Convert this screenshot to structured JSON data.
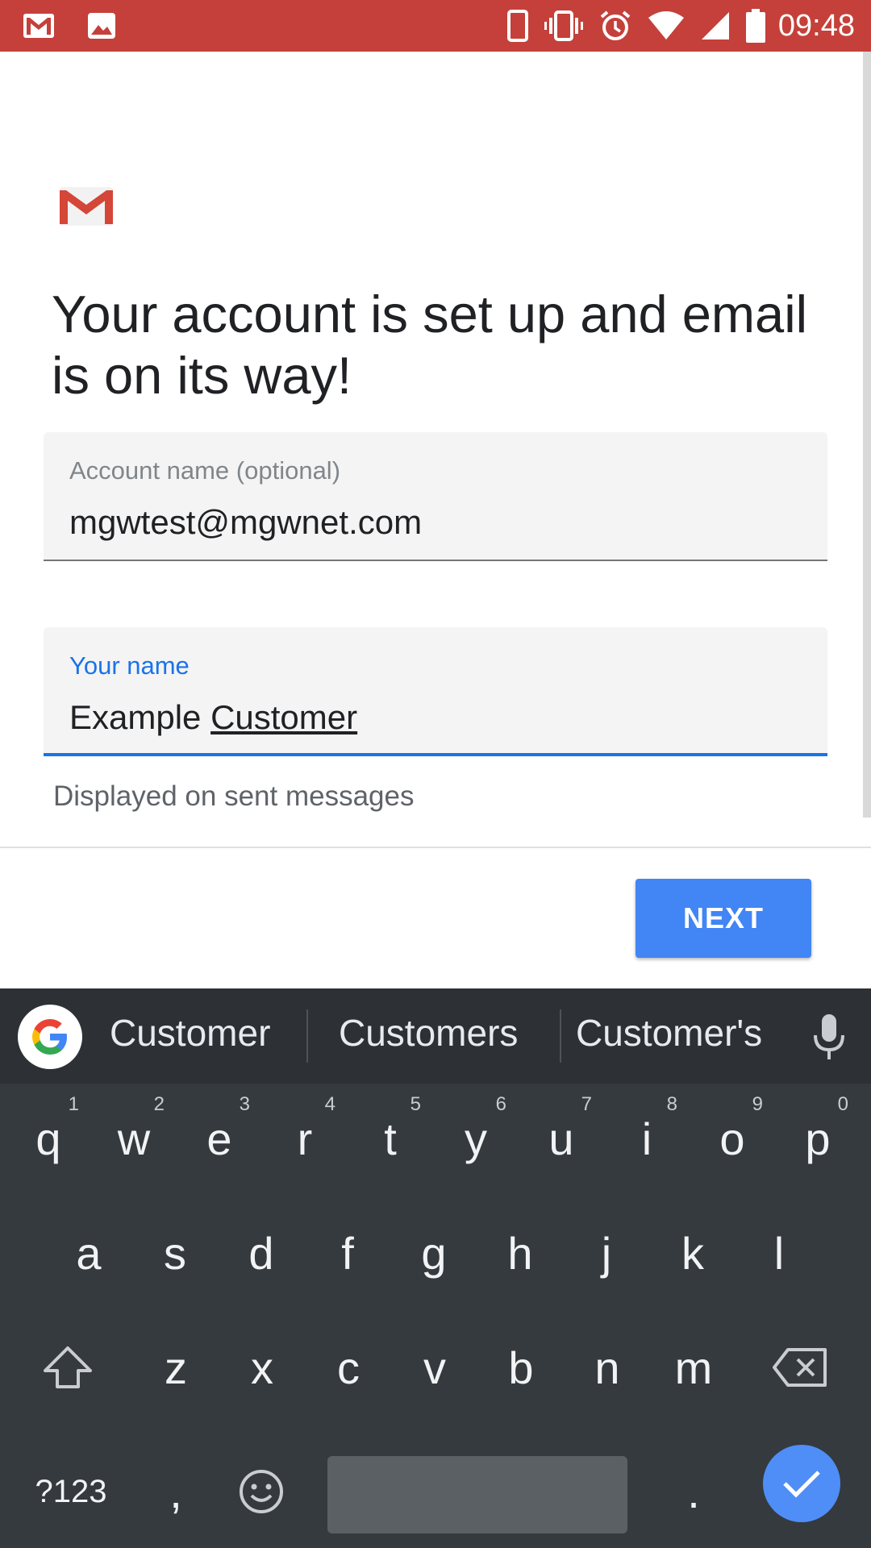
{
  "status_bar": {
    "time": "09:48",
    "left_icons": [
      "gmail-notification-icon",
      "image-notification-icon"
    ],
    "right_icons": [
      "phone-icon",
      "vibrate-icon",
      "alarm-icon",
      "wifi-icon",
      "signal-icon",
      "battery-icon"
    ]
  },
  "page": {
    "title": "Your account is set up and email is on its way!",
    "account_field": {
      "label": "Account name (optional)",
      "value": "mgwtest@mgwnet.com"
    },
    "name_field": {
      "label": "Your name",
      "value_first": "Example ",
      "value_composing": "Customer"
    },
    "helper_text": "Displayed on sent messages",
    "next_label": "NEXT"
  },
  "keyboard": {
    "suggestions": [
      "Customer",
      "Customers",
      "Customer's"
    ],
    "row1": [
      {
        "k": "q",
        "h": "1"
      },
      {
        "k": "w",
        "h": "2"
      },
      {
        "k": "e",
        "h": "3"
      },
      {
        "k": "r",
        "h": "4"
      },
      {
        "k": "t",
        "h": "5"
      },
      {
        "k": "y",
        "h": "6"
      },
      {
        "k": "u",
        "h": "7"
      },
      {
        "k": "i",
        "h": "8"
      },
      {
        "k": "o",
        "h": "9"
      },
      {
        "k": "p",
        "h": "0"
      }
    ],
    "row2": [
      "a",
      "s",
      "d",
      "f",
      "g",
      "h",
      "j",
      "k",
      "l"
    ],
    "row3": [
      "z",
      "x",
      "c",
      "v",
      "b",
      "n",
      "m"
    ],
    "symbols_label": "?123",
    "comma": ",",
    "period": "."
  },
  "colors": {
    "status_bar": "#c5403a",
    "accent": "#1a73e8",
    "button": "#4285f4",
    "keyboard_bg": "#353a3e"
  }
}
